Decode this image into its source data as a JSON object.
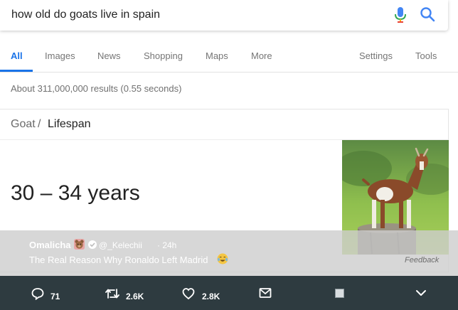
{
  "search": {
    "query": "how old do goats live in spain"
  },
  "tabs": {
    "items": [
      "All",
      "Images",
      "News",
      "Shopping",
      "Maps",
      "More"
    ],
    "right": [
      "Settings",
      "Tools"
    ],
    "active": "All"
  },
  "results": {
    "stats": "About 311,000,000 results (0.55 seconds)"
  },
  "card": {
    "parent": "Goat",
    "separator": "/",
    "current": "Lifespan",
    "answer": "30 – 34 years",
    "feedback": "Feedback"
  },
  "tweet": {
    "author": "Omalicha",
    "handle": "@_Kelechii",
    "time": "· 24h",
    "text": "The Real Reason Why Ronaldo Left Madrid"
  },
  "actions": {
    "replies": "71",
    "retweets": "2.6K",
    "likes": "2.8K"
  },
  "icons": [
    "mic-icon",
    "search-icon",
    "bear-emoji-icon",
    "verified-icon",
    "crying-laugh-emoji-icon",
    "reply-icon",
    "retweet-icon",
    "heart-icon",
    "mail-icon",
    "image-icon",
    "chevron-down-icon"
  ],
  "colors": {
    "accent": "#1a73e8",
    "action_bar": "#2e3b40",
    "overlay": "#cdcdcd"
  }
}
